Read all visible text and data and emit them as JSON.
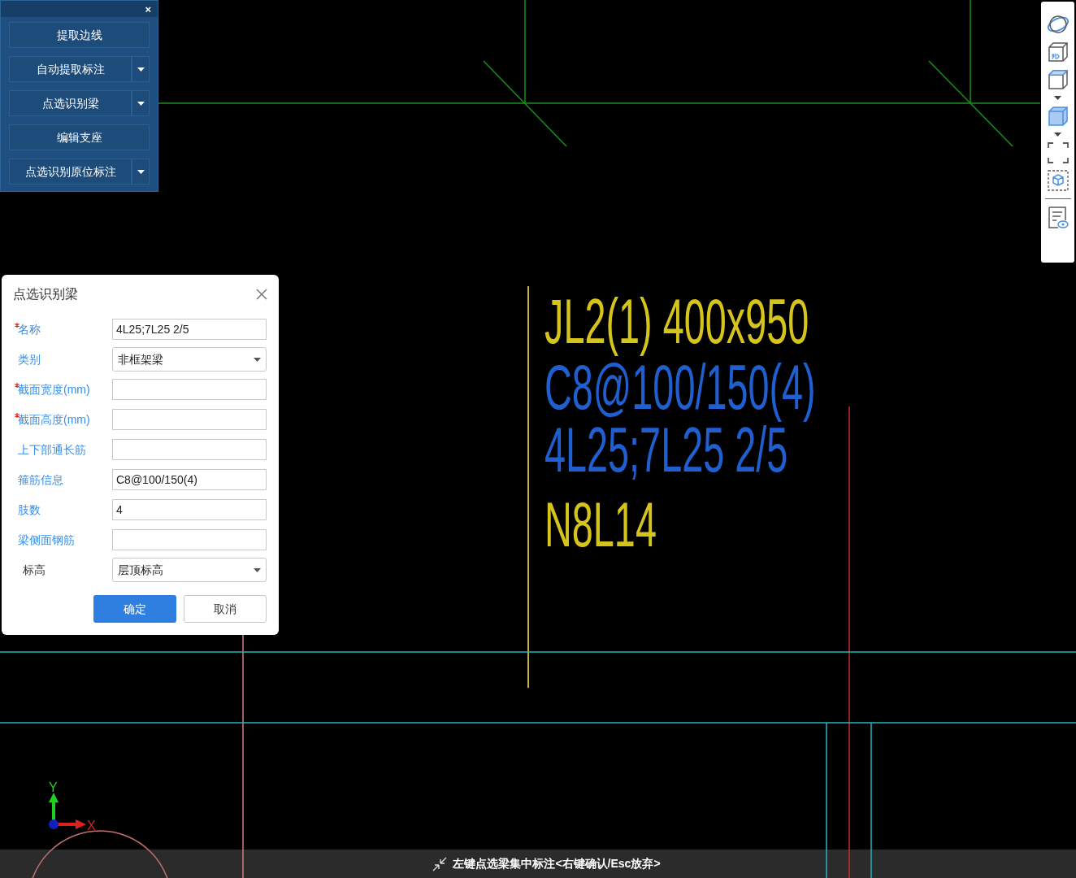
{
  "tool_panel": {
    "close": "×",
    "buttons": [
      {
        "label": "提取边线",
        "dropdown": false
      },
      {
        "label": "自动提取标注",
        "dropdown": true
      },
      {
        "label": "点选识别梁",
        "dropdown": true
      },
      {
        "label": "编辑支座",
        "dropdown": false
      },
      {
        "label": "点选识别原位标注",
        "dropdown": true
      }
    ]
  },
  "dialog": {
    "title": "点选识别梁",
    "fields": [
      {
        "label": "名称",
        "required": true,
        "highlighted": true,
        "kind": "input",
        "value": "4L25;7L25 2/5"
      },
      {
        "label": "类别",
        "required": false,
        "highlighted": true,
        "kind": "select",
        "value": "非框架梁"
      },
      {
        "label": "截面宽度(mm)",
        "required": true,
        "highlighted": true,
        "kind": "input"
      },
      {
        "label": "截面高度(mm)",
        "required": true,
        "highlighted": true,
        "kind": "input"
      },
      {
        "label": "上下部通长筋",
        "required": false,
        "highlighted": true,
        "kind": "input"
      },
      {
        "label": "箍筋信息",
        "required": false,
        "highlighted": true,
        "kind": "input",
        "value": "C8@100/150(4)"
      },
      {
        "label": "肢数",
        "required": false,
        "highlighted": true,
        "kind": "input",
        "value": "4"
      },
      {
        "label": "梁侧面钢筋",
        "required": false,
        "highlighted": true,
        "kind": "input"
      },
      {
        "label": "标高",
        "required": false,
        "highlighted": false,
        "kind": "select",
        "value": "层顶标高"
      }
    ],
    "buttons": [
      {
        "label": "确定",
        "primary": true
      },
      {
        "label": "取消",
        "primary": false
      }
    ]
  },
  "drawing": {
    "texts": [
      {
        "text": "JL2(1) 400x950",
        "color": "#d4c41c"
      },
      {
        "text": "C8@100/150(4)",
        "color": "#1f5fcf"
      },
      {
        "text": "4L25;7L25 2/5",
        "color": "#1f5fcf"
      },
      {
        "text": "N8L14",
        "color": "#d4c41c"
      }
    ],
    "axis": {
      "x": "X",
      "y": "Y"
    }
  },
  "status_bar": {
    "text": "左键点选梁集中标注<右键确认/Esc放弃>"
  }
}
